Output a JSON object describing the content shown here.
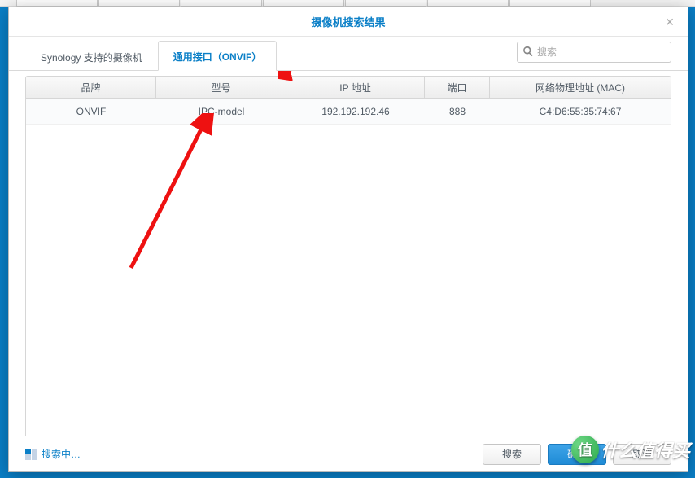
{
  "dialog": {
    "title": "摄像机搜索结果",
    "close_label": "×"
  },
  "tabs": [
    {
      "label": "Synology 支持的摄像机",
      "active": false
    },
    {
      "label": "通用接口（ONVIF）",
      "active": true
    }
  ],
  "search": {
    "placeholder": "搜索"
  },
  "table": {
    "columns": {
      "brand": "品牌",
      "model": "型号",
      "ip": "IP 地址",
      "port": "端口",
      "mac": "网络物理地址 (MAC)"
    },
    "rows": [
      {
        "brand": "ONVIF",
        "model": "IPC-model",
        "ip": "192.192.192.46",
        "port": "888",
        "mac": "C4:D6:55:35:74:67"
      }
    ]
  },
  "footer": {
    "status": "搜索中…",
    "buttons": {
      "search": "搜索",
      "confirm": "确定",
      "cancel": "取消"
    }
  },
  "watermark": {
    "badge": "值",
    "text": "什么值得买"
  }
}
